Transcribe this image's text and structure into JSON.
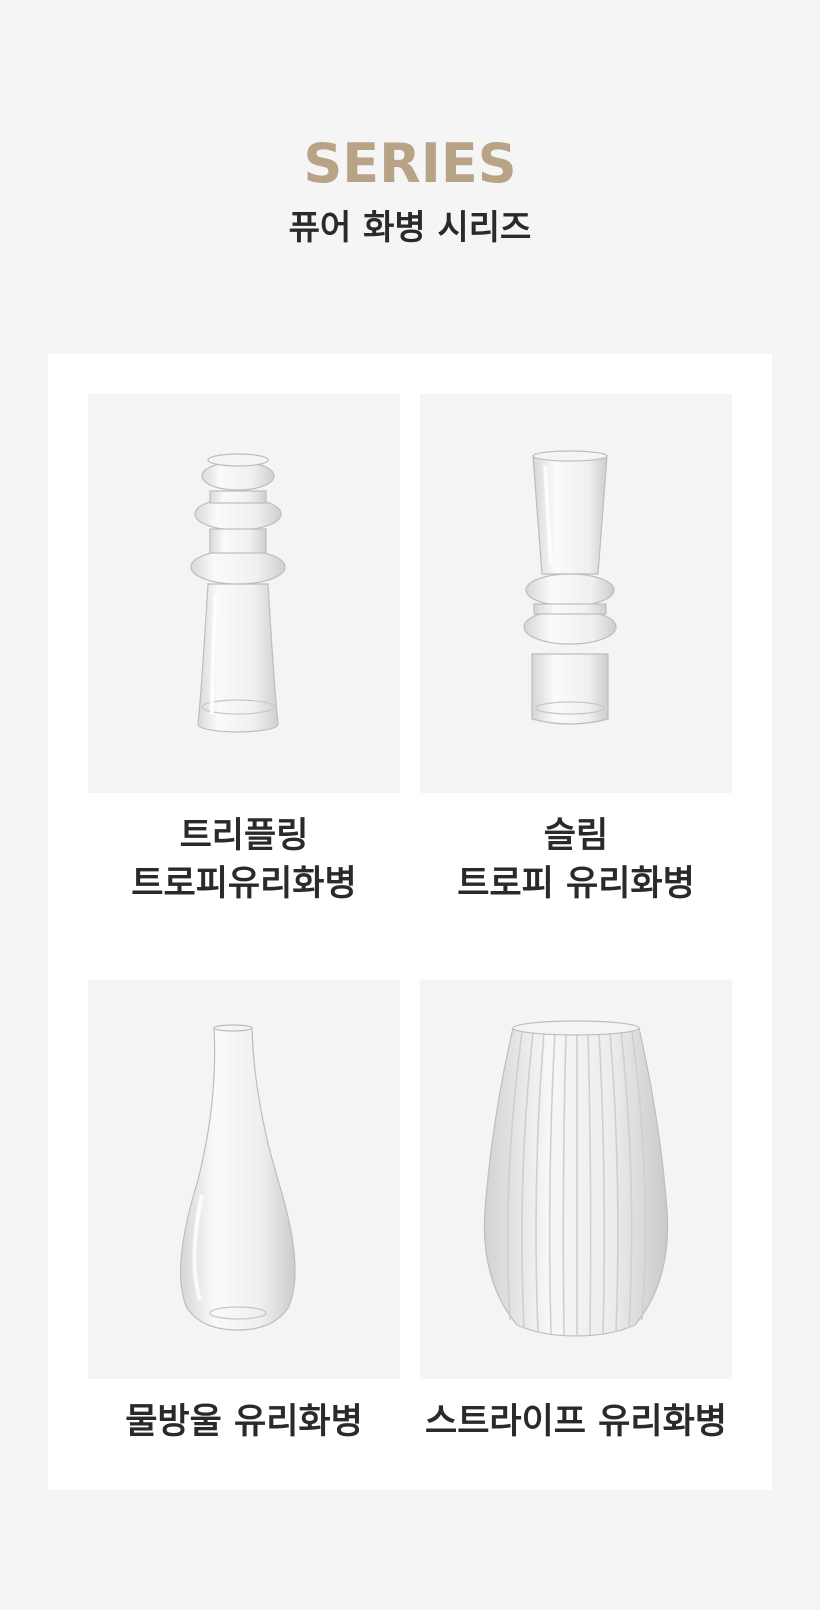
{
  "header": {
    "title": "SERIES",
    "subtitle": "퓨어 화병 시리즈"
  },
  "products": [
    {
      "name_line1": "트리플링",
      "name_line2": "트로피유리화병",
      "image": "triple-ring-vase"
    },
    {
      "name_line1": "슬림",
      "name_line2": "트로피 유리화병",
      "image": "slim-trophy-vase"
    },
    {
      "name_line1": "물방울 유리화병",
      "name_line2": "",
      "image": "waterdrop-vase"
    },
    {
      "name_line1": "스트라이프 유리화병",
      "name_line2": "",
      "image": "stripe-vase"
    }
  ],
  "colors": {
    "background": "#f5f5f5",
    "card": "#ffffff",
    "accent": "#b9a386",
    "text": "#2a2a2a",
    "thumb_bg": "#f4f4f4"
  }
}
